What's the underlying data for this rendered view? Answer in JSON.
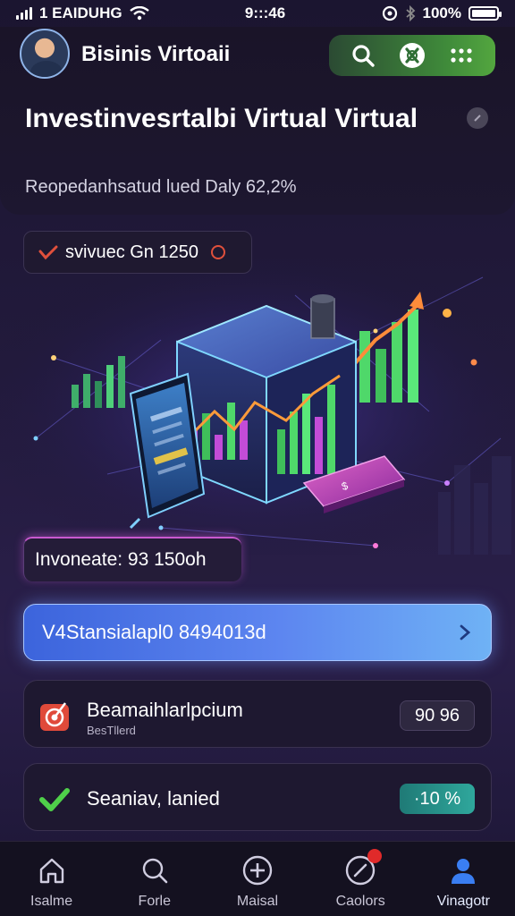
{
  "status_bar": {
    "carrier": "1 EAIDUHG",
    "time": "9:::46",
    "battery_percent": "100%",
    "battery_level": 1.0
  },
  "header": {
    "brand_name": "Bisinis Virtoaii",
    "title": "Investinvesrtalbi Virtual Virtual",
    "subtitle": "Reopedanhsatud lued Daly 62,2%",
    "icons": {
      "search": "search-icon",
      "exchange": "exchange-icon",
      "grid": "grid-icon"
    }
  },
  "stats": {
    "label": "svivuec Gn 1250"
  },
  "invest_card": {
    "label": "Invoneate: 93 150oh"
  },
  "cta": {
    "label": "V4Stansialapl0 8494013d"
  },
  "list": [
    {
      "title": "Beamaihlarlpcium",
      "subtitle": "BesTllerd",
      "badge": "90 96",
      "icon": "target-icon"
    },
    {
      "title": "Seaniav, lanied",
      "subtitle": "",
      "badge": "·10 %",
      "icon": "check-icon"
    }
  ],
  "bottom_nav": [
    {
      "label": "Isalme",
      "icon": "home-icon"
    },
    {
      "label": "Forle",
      "icon": "search-icon"
    },
    {
      "label": "Maisal",
      "icon": "add-circle-icon"
    },
    {
      "label": "Caolors",
      "icon": "compass-icon"
    },
    {
      "label": "Vinagotr",
      "icon": "user-icon"
    }
  ],
  "colors": {
    "accent_green": "#53a63f",
    "cta_blue": "#5d86f0",
    "badge_teal": "#2fa79c",
    "alert_red": "#e02a2a"
  }
}
